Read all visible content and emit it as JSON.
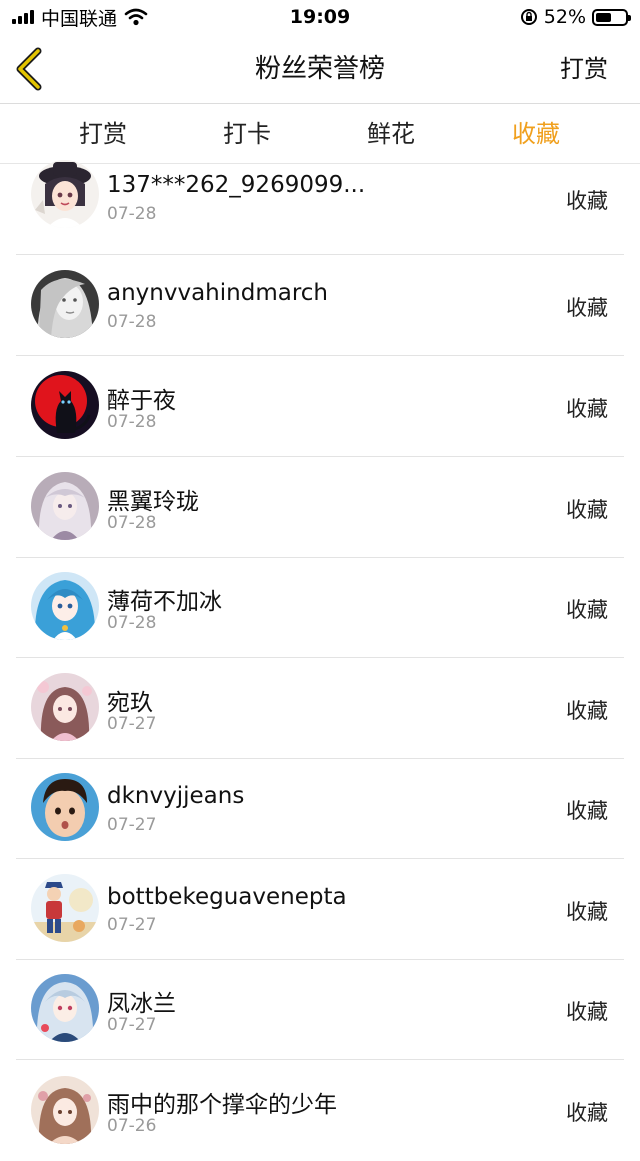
{
  "status_bar": {
    "carrier": "中国联通",
    "time": "19:09",
    "battery_percent": "52%",
    "battery_level": 0.52,
    "icons": [
      "signal-icon",
      "wifi-icon",
      "lock-rotation-icon",
      "battery-icon"
    ]
  },
  "nav": {
    "title": "粉丝荣誉榜",
    "right_action": "打赏",
    "back_icon": "chevron-left-icon"
  },
  "tabs": [
    {
      "label": "打赏",
      "active": false
    },
    {
      "label": "打卡",
      "active": false
    },
    {
      "label": "鲜花",
      "active": false
    },
    {
      "label": "收藏",
      "active": true
    }
  ],
  "colors": {
    "accent": "#f0a01e",
    "back_icon": "#c9a400",
    "divider": "#e3e3e3",
    "secondary_text": "#9a9a9a"
  },
  "rows": [
    {
      "name": "137***262_9269099...",
      "date": "07-28",
      "action": "收藏",
      "avatar": "anime-girl-hat-avatar"
    },
    {
      "name": "anynvvahindmarch",
      "date": "07-28",
      "action": "收藏",
      "avatar": "woman-portrait-avatar"
    },
    {
      "name": "醉于夜",
      "date": "07-28",
      "action": "收藏",
      "avatar": "black-cat-red-moon-avatar"
    },
    {
      "name": "黑翼玲珑",
      "date": "07-28",
      "action": "收藏",
      "avatar": "anime-white-hair-avatar"
    },
    {
      "name": "薄荷不加冰",
      "date": "07-28",
      "action": "收藏",
      "avatar": "anime-blue-hair-avatar"
    },
    {
      "name": "宛玖",
      "date": "07-27",
      "action": "收藏",
      "avatar": "anime-pink-girl-avatar"
    },
    {
      "name": "dknvyjjeans",
      "date": "07-27",
      "action": "收藏",
      "avatar": "child-face-avatar"
    },
    {
      "name": "bottbekeguavenepta",
      "date": "07-27",
      "action": "收藏",
      "avatar": "cartoon-boy-avatar"
    },
    {
      "name": "凤冰兰",
      "date": "07-27",
      "action": "收藏",
      "avatar": "anime-silver-hair-avatar"
    },
    {
      "name": "雨中的那个撑伞的少年",
      "date": "07-26",
      "action": "收藏",
      "avatar": "anime-umbrella-avatar"
    }
  ]
}
